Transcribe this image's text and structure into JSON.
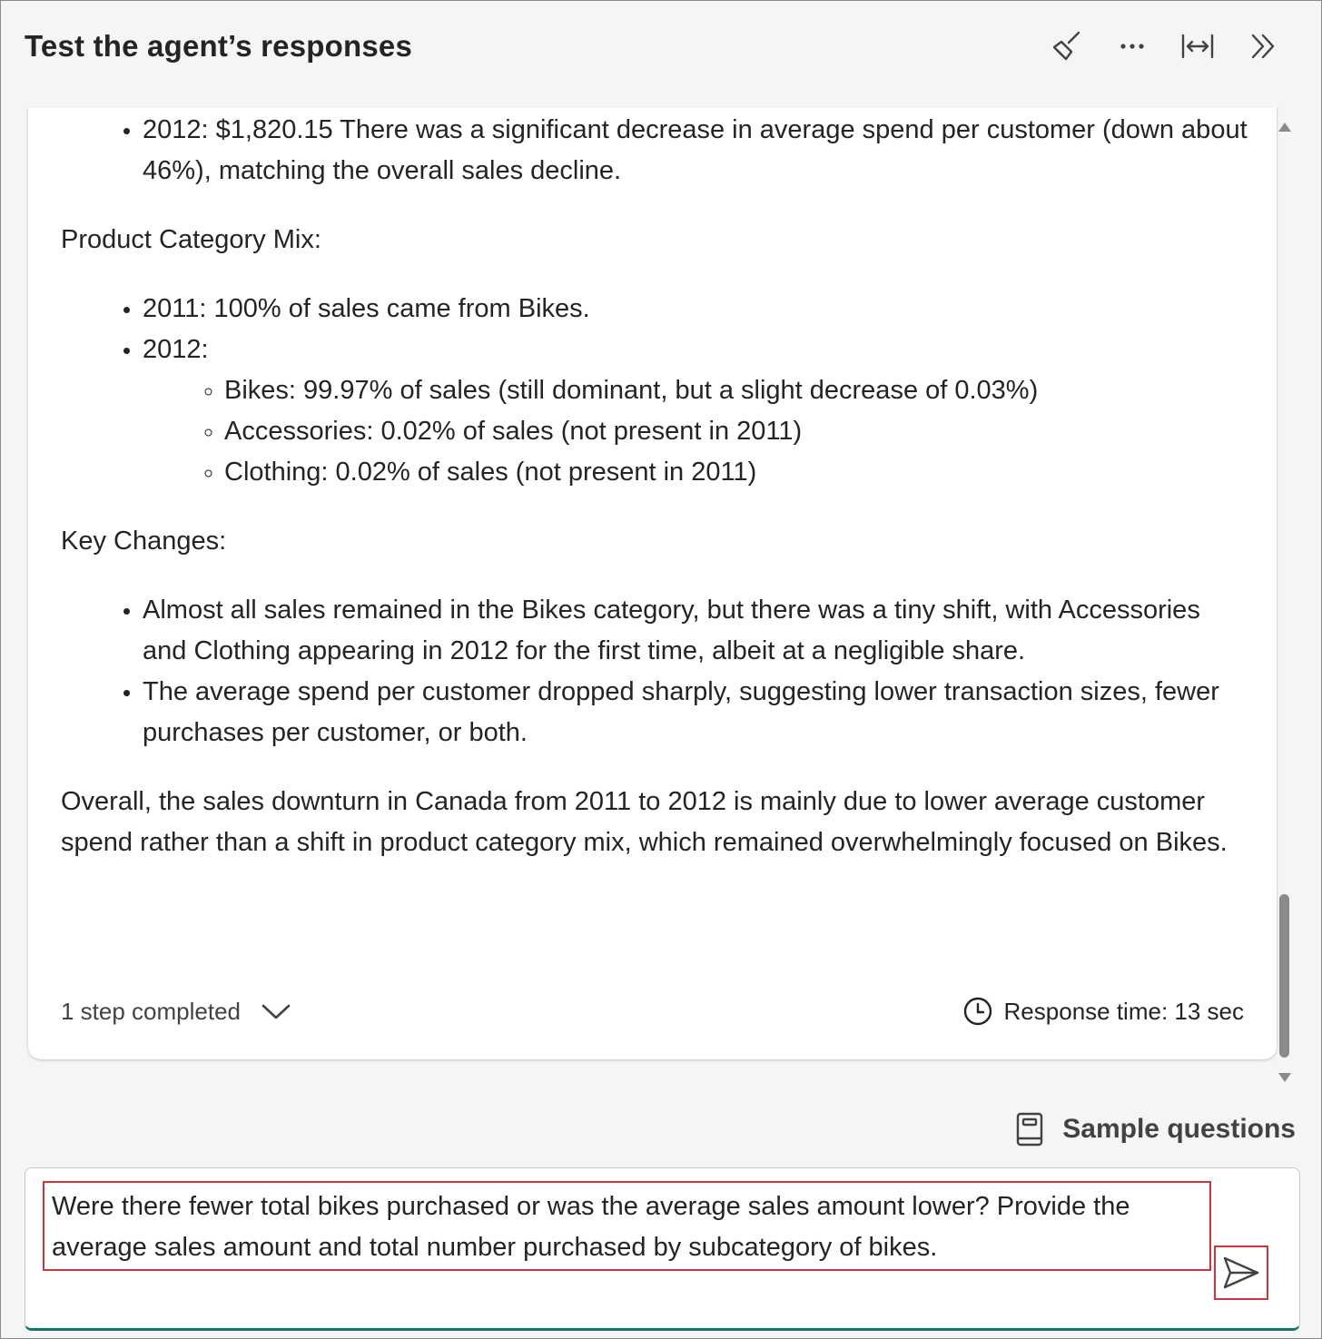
{
  "header": {
    "title": "Test the agent’s responses",
    "icons": [
      "broom-icon",
      "more-icon",
      "expand-width-icon",
      "collapse-panel-icon"
    ]
  },
  "response": {
    "top_bullet": "2012: $1,820.15 There was a significant decrease in average spend per customer (down about 46%), matching the overall sales decline.",
    "mix_heading": "Product Category Mix:",
    "mix_items": [
      "2011: 100% of sales came from Bikes.",
      "2012:"
    ],
    "mix_sub_items": [
      "Bikes: 99.97% of sales (still dominant, but a slight decrease of 0.03%)",
      "Accessories: 0.02% of sales (not present in 2011)",
      "Clothing: 0.02% of sales (not present in 2011)"
    ],
    "changes_heading": "Key Changes:",
    "changes_items": [
      "Almost all sales remained in the Bikes category, but there was a tiny shift, with Accessories and Clothing appearing in 2012 for the first time, albeit at a negligible share.",
      "The average spend per customer dropped sharply, suggesting lower transaction sizes, fewer purchases per customer, or both."
    ],
    "summary": "Overall, the sales downturn in Canada from 2011 to 2012 is mainly due to lower average customer spend rather than a shift in product category mix, which remained overwhelmingly focused on Bikes.",
    "steps_label": "1 step completed",
    "response_time": "Response time: 13 sec"
  },
  "sample_questions_label": "Sample questions",
  "input": {
    "value": "Were there fewer total bikes purchased or was the average sales amount lower? Provide the average sales amount and total number purchased by subcategory of bikes."
  },
  "colors": {
    "highlight": "#d13438",
    "input_underline": "#117865"
  }
}
